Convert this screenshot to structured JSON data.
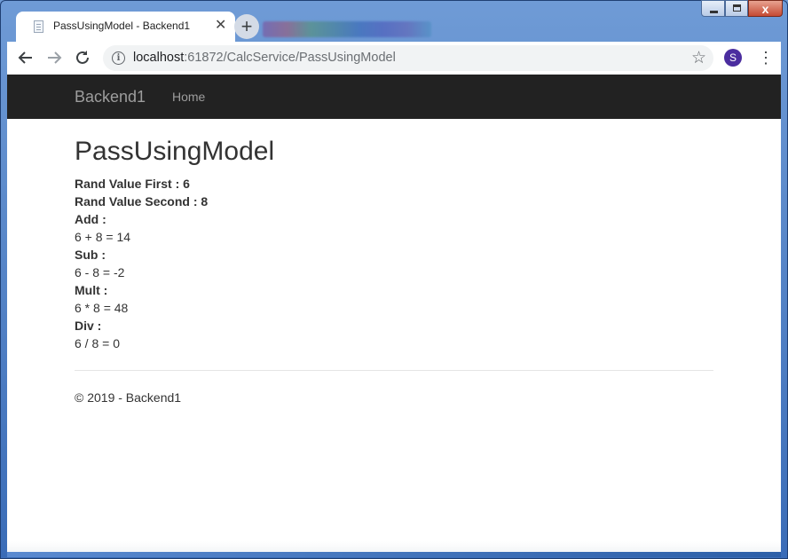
{
  "browser": {
    "tab": {
      "title": "PassUsingModel - Backend1",
      "favicon": "page-icon",
      "close_label": "✕"
    },
    "new_tab_label": "+",
    "window_buttons": {
      "close_label": "x"
    },
    "url": {
      "host": "localhost",
      "rest": ":61872/CalcService/PassUsingModel"
    },
    "avatar_letter": "S",
    "avatar_color": "#4b2d9f",
    "icons": {
      "back": "back-arrow-icon",
      "forward": "forward-arrow-icon",
      "reload": "reload-icon",
      "info": "info-icon",
      "star": "star-icon",
      "menu": "menu-dots-icon"
    }
  },
  "page": {
    "navbar": {
      "brand": "Backend1",
      "home": "Home",
      "background": "#222222"
    },
    "title": "PassUsingModel",
    "lines": [
      {
        "text": "Rand Value First : 6",
        "bold": true
      },
      {
        "text": "Rand Value Second : 8",
        "bold": true
      },
      {
        "text": "Add :",
        "bold": true
      },
      {
        "text": "6 + 8 = 14",
        "bold": false
      },
      {
        "text": "Sub :",
        "bold": true
      },
      {
        "text": "6 - 8 = -2",
        "bold": false
      },
      {
        "text": "Mult :",
        "bold": true
      },
      {
        "text": "6 * 8 = 48",
        "bold": false
      },
      {
        "text": "Div :",
        "bold": true
      },
      {
        "text": "6 / 8 = 0",
        "bold": false
      }
    ],
    "footer": "© 2019 - Backend1"
  }
}
